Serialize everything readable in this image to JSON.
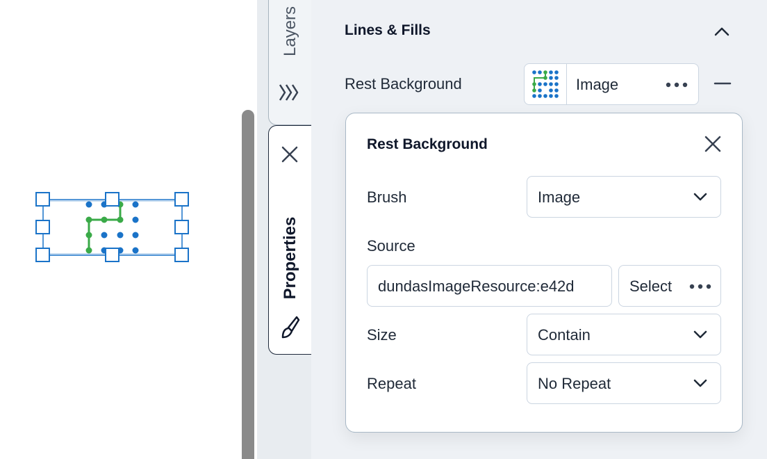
{
  "tabs": {
    "layers_label": "Layers",
    "properties_label": "Properties",
    "layers_icon": "layers-chevrons-icon",
    "properties_icon": "paint-brush-icon",
    "close_icon": "close-icon"
  },
  "section": {
    "title": "Lines & Fills",
    "collapse_icon": "chevron-up-icon"
  },
  "rest_background": {
    "label": "Rest Background",
    "value": "Image",
    "more_icon": "ellipsis-icon",
    "remove_icon": "minus-icon"
  },
  "popup": {
    "title": "Rest Background",
    "brush": {
      "label": "Brush",
      "value": "Image"
    },
    "source": {
      "label": "Source",
      "value": "dundasImageResource:e42d",
      "select_label": "Select"
    },
    "size": {
      "label": "Size",
      "value": "Contain"
    },
    "repeat": {
      "label": "Repeat",
      "value": "No Repeat"
    }
  },
  "colors": {
    "accent_blue": "#1a73c8",
    "accent_green": "#3aaa48",
    "panel_bg": "#eef1f5"
  }
}
